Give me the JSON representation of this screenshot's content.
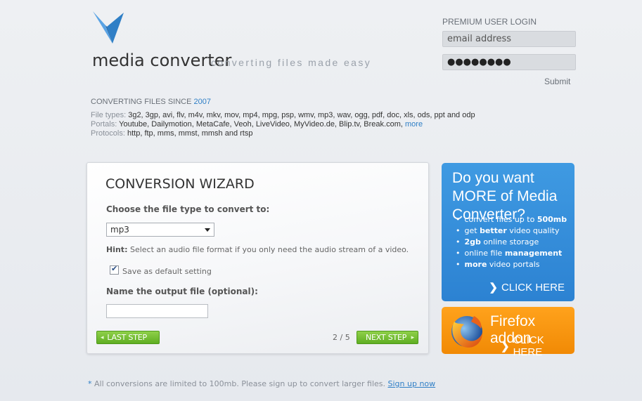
{
  "brand": {
    "name": "media converter",
    "tagline": "converting files made easy",
    "logo_icon": "bird-logo-icon",
    "logo_color": "#3b8fd9"
  },
  "login": {
    "title": "PREMIUM USER LOGIN",
    "email_value": "email address",
    "password_value": "●●●●●●●●",
    "submit_label": "Submit"
  },
  "info": {
    "since_text": "CONVERTING FILES SINCE ",
    "since_year": "2007",
    "file_types_label": "File types:",
    "file_types": "3g2, 3gp, avi, flv, m4v, mkv, mov, mp4, mpg, psp, wmv, mp3, wav, ogg, pdf, doc, xls, ods, ppt and odp",
    "portals_label": "Portals:",
    "portals": "Youtube, Dailymotion, MetaCafe, Veoh, LiveVideo, MyVideo.de, Blip.tv, Break.com,",
    "portals_more": "more",
    "protocols_label": "Protocols:",
    "protocols": "http, ftp, mms, mmst, mmsh and rtsp"
  },
  "wizard": {
    "title": "CONVERSION WIZARD",
    "choose_label": "Choose the file type to convert to:",
    "selected_type": "mp3",
    "hint_label": "Hint:",
    "hint_text": "Select an audio file format if you only need the audio stream of a video.",
    "default_checked": true,
    "default_label": "Save as default setting",
    "name_label": "Name the output file (optional):",
    "name_value": "",
    "last_step_label": "LAST STEP",
    "step_count": "2 / 5",
    "next_step_label": "NEXT STEP",
    "button_color": "#6fbe2e"
  },
  "promo": {
    "headline": "Do you want MORE of Media Converter?",
    "bullets": [
      {
        "pre": "convert files up to ",
        "bold": "500mb",
        "post": ""
      },
      {
        "pre": "get ",
        "bold": "better",
        "post": " video quality"
      },
      {
        "pre": "",
        "bold": "2gb",
        "post": " online storage"
      },
      {
        "pre": "online file ",
        "bold": "management",
        "post": ""
      },
      {
        "pre": "",
        "bold": "more",
        "post": " video portals"
      }
    ],
    "cta_label": "CLICK HERE",
    "bg_color": "#3a92dc"
  },
  "firefox": {
    "title": "Firefox addon",
    "cta_label": "CLICK HERE",
    "bg_color": "#f7941d",
    "logo_icon": "firefox-logo-icon"
  },
  "footer": {
    "asterisk": "*",
    "text": " All conversions are limited to 100mb. Please sign up to convert larger files. ",
    "signup_label": "Sign up now"
  }
}
